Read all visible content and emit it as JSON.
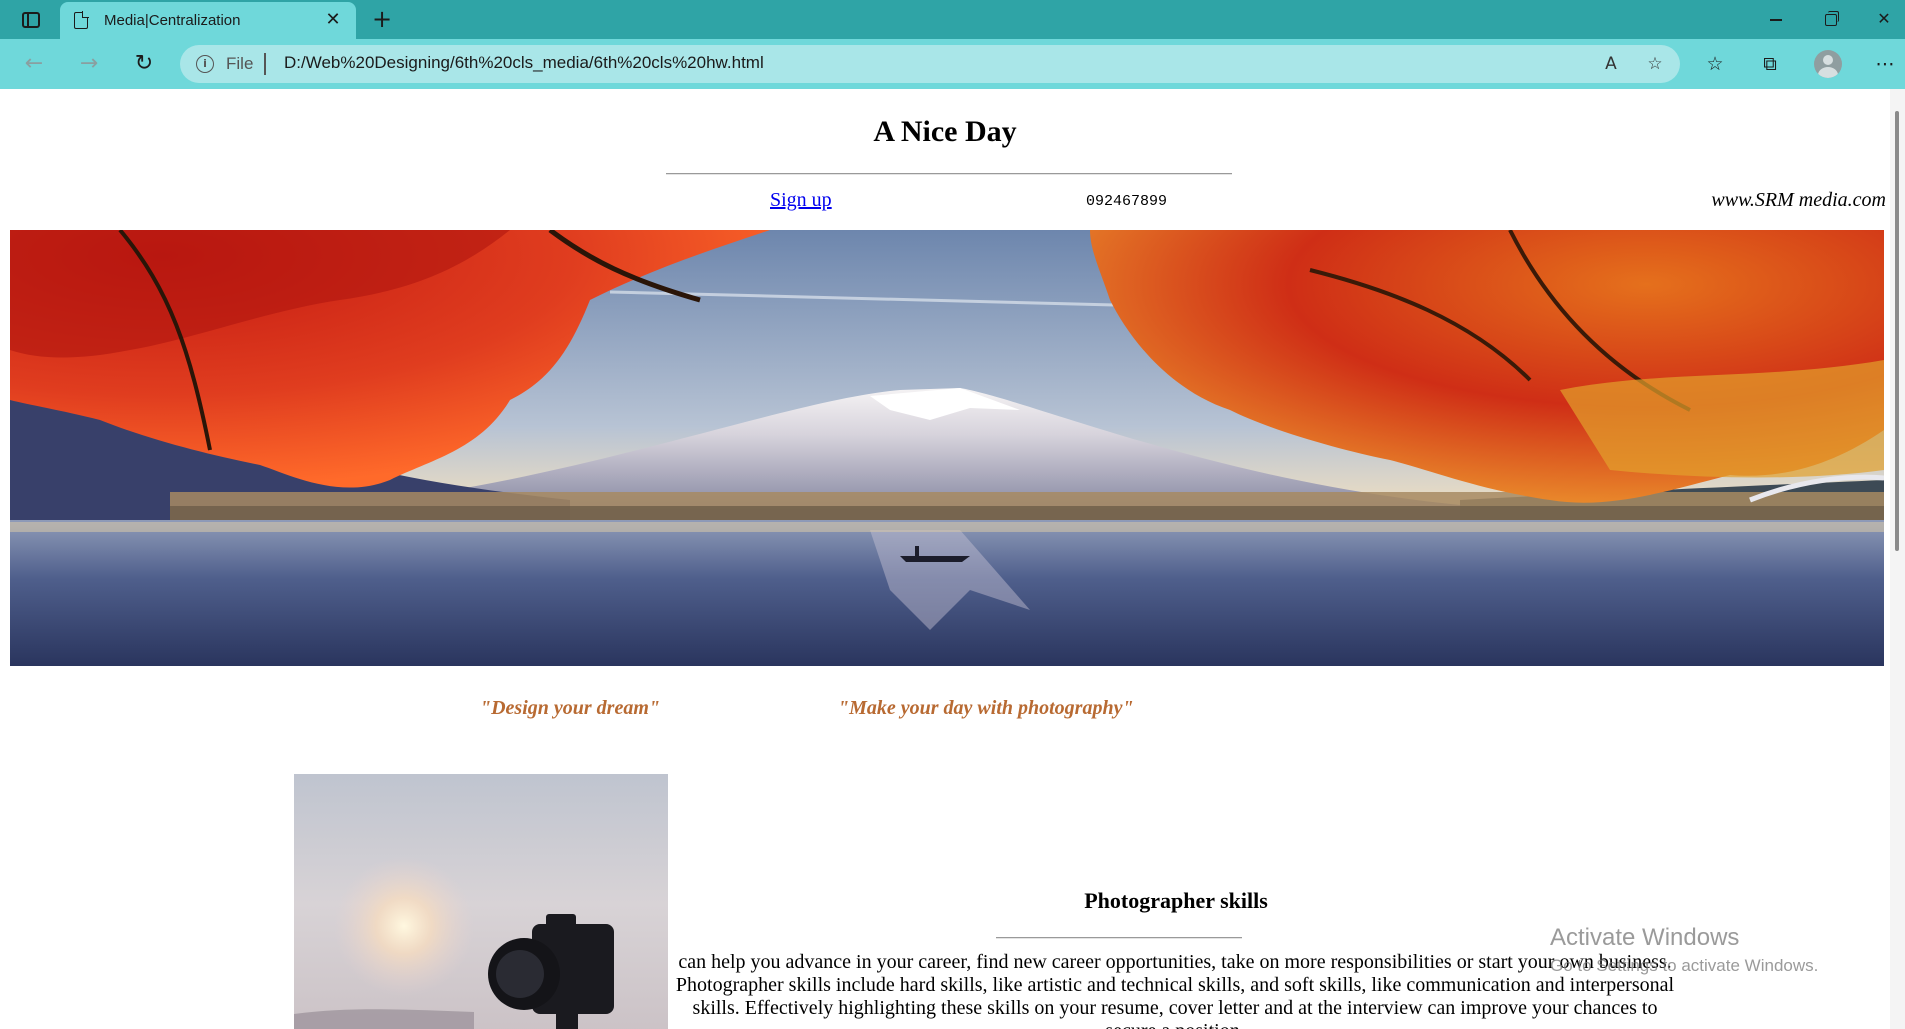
{
  "browser": {
    "tab_title": "Media|Centralization",
    "address_scheme": "File",
    "address_url": "D:/Web%20Designing/6th%20cls_media/6th%20cls%20hw.html"
  },
  "page": {
    "heading": "A Nice Day",
    "signup_link": "Sign up",
    "phone": "092467899",
    "website": "www.SRM media.com",
    "quote_left": "\"Design your dream\"",
    "quote_right": "\"Make your day with photography\"",
    "skills_title": "Photographer skills",
    "skills_text": "can help you advance in your career, find new career opportunities, take on more responsibilities or start your own business. Photographer skills include hard skills, like artistic and technical skills, and soft skills, like communication and interpersonal skills. Effectively highlighting these skills on your resume, cover letter and at the interview can improve your chances to secure a position."
  },
  "overlay": {
    "activate_title": "Activate Windows",
    "activate_subtitle": "Go to Settings to activate Windows."
  },
  "colors": {
    "tabbar": "#2fa4a6",
    "toolbar": "#6fd8da",
    "address_bar": "#a9e6e8",
    "quote_color": "#b86a32",
    "link_color": "#0000ee"
  },
  "icons": {
    "tab_actions": "tab-actions-icon",
    "page": "page-icon",
    "close": "close-icon",
    "new_tab": "plus-icon",
    "back": "arrow-left-icon",
    "forward": "arrow-right-icon",
    "refresh": "refresh-icon",
    "info": "info-icon",
    "read_aloud": "read-aloud-icon",
    "add_favorite": "star-plus-icon",
    "favorites": "favorites-list-icon",
    "collections": "collections-icon",
    "profile": "avatar-icon",
    "more": "more-icon"
  }
}
